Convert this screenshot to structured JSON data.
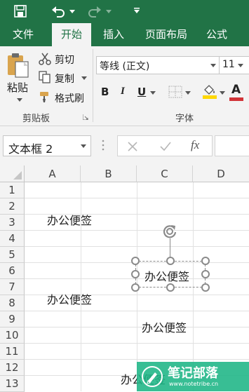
{
  "colors": {
    "accent": "#217346",
    "font_color_red": "#d13438",
    "highlight_yellow": "#ffd800",
    "watermark": "#1cb585"
  },
  "ribbon": {
    "tabs": [
      {
        "label": "文件"
      },
      {
        "label": "开始"
      },
      {
        "label": "插入"
      },
      {
        "label": "页面布局"
      },
      {
        "label": "公式"
      }
    ],
    "clipboard": {
      "paste_label": "粘贴",
      "cut_label": "剪切",
      "copy_label": "复制",
      "format_painter_label": "格式刷",
      "group_label": "剪贴板"
    },
    "font": {
      "font_name": "等线 (正文)",
      "font_size": "11",
      "bold_label": "B",
      "italic_label": "I",
      "underline_label": "U",
      "font_color_label": "A",
      "group_label": "字体"
    }
  },
  "formula_bar": {
    "name_box": "文本框 2",
    "fx_label": "fx",
    "formula": ""
  },
  "sheet": {
    "columns": [
      "A",
      "B",
      "C",
      "D"
    ],
    "rows": [
      "1",
      "2",
      "3",
      "4",
      "5",
      "6",
      "7",
      "8",
      "9",
      "10",
      "11",
      "12",
      "13"
    ],
    "cells": {
      "a3": "办公便签",
      "a7": "办公便签",
      "c9": "办公便签",
      "c13": "办公便签"
    },
    "textbox": {
      "text": "办公便签"
    }
  },
  "watermark": {
    "title": "笔记部落",
    "url": "www.notetribe.cn"
  }
}
